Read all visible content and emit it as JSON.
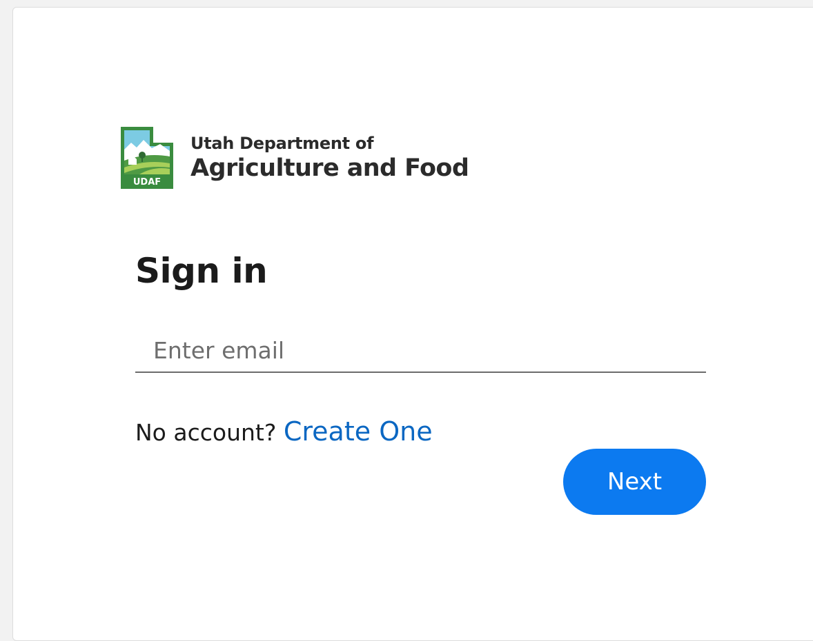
{
  "branding": {
    "logo_badge": "UDAF",
    "line1": "Utah Department of",
    "line2": "Agriculture and Food",
    "colors": {
      "frame_green": "#3a8c3f",
      "sky_blue": "#7ccbe3",
      "field_green": "#4f9a44",
      "field_light": "#a8cf5a"
    }
  },
  "signin": {
    "heading": "Sign in",
    "email_placeholder": "Enter email",
    "email_value": "",
    "no_account_text": "No account?",
    "create_link": "Create One",
    "next_label": "Next"
  },
  "colors": {
    "accent": "#0c7af0",
    "link": "#0b67c2"
  }
}
